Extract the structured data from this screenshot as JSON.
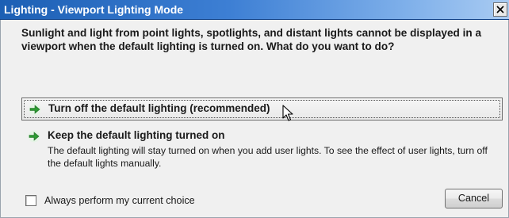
{
  "window": {
    "title": "Lighting - Viewport Lighting Mode",
    "close_glyph": "×"
  },
  "message": "Sunlight and light from point lights, spotlights, and distant lights cannot be displayed in a viewport when the default lighting is turned on. What do you want to do?",
  "options": [
    {
      "icon": "green-arrow-icon",
      "title": "Turn off the default lighting (recommended)",
      "description": ""
    },
    {
      "icon": "green-arrow-icon",
      "title": "Keep the default lighting turned on",
      "description": "The default lighting will stay turned on when you add user lights. To see the effect of user lights, turn off the default lights manually."
    }
  ],
  "footer": {
    "checkbox_label": "Always perform my current choice",
    "checkbox_checked": false,
    "cancel_label": "Cancel"
  },
  "colors": {
    "titlebar_start": "#1c5fb4",
    "titlebar_end": "#a9cbf2",
    "arrow_green": "#2e9a33",
    "background": "#f0f0f0"
  }
}
